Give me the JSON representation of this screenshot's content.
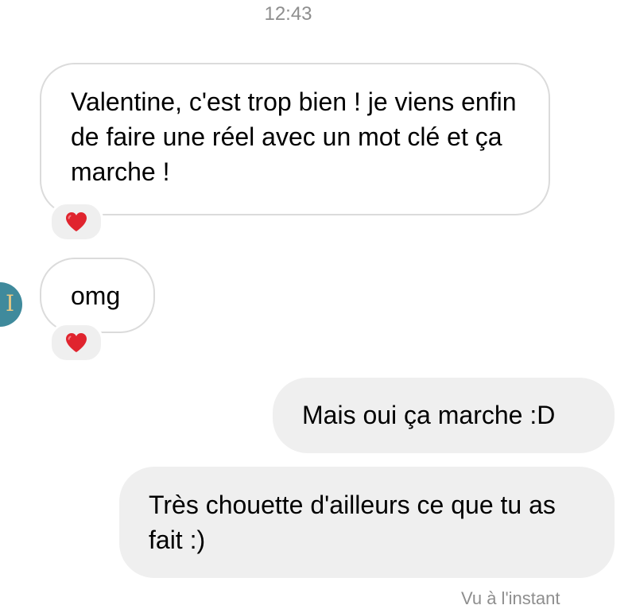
{
  "timestamp": "12:43",
  "messages": [
    {
      "direction": "incoming",
      "text": "Valentine, c'est trop bien ! je viens enfin de faire une réel avec un mot clé et ça marche !",
      "reaction": "heart"
    },
    {
      "direction": "incoming",
      "text": "omg",
      "reaction": "heart"
    },
    {
      "direction": "outgoing",
      "text": "Mais oui ça marche :D"
    },
    {
      "direction": "outgoing",
      "text": "Très chouette d'ailleurs ce que tu as fait :)"
    }
  ],
  "seen_status": "Vu à l'instant",
  "colors": {
    "outgoing_bubble": "#efefef",
    "incoming_border": "#dbdbdb",
    "meta_text": "#8e8e8e",
    "heart": "#e0242e",
    "avatar_bg": "#3f8a9c"
  },
  "icons": {
    "reaction": "heart-icon",
    "avatar": "contact-avatar"
  }
}
